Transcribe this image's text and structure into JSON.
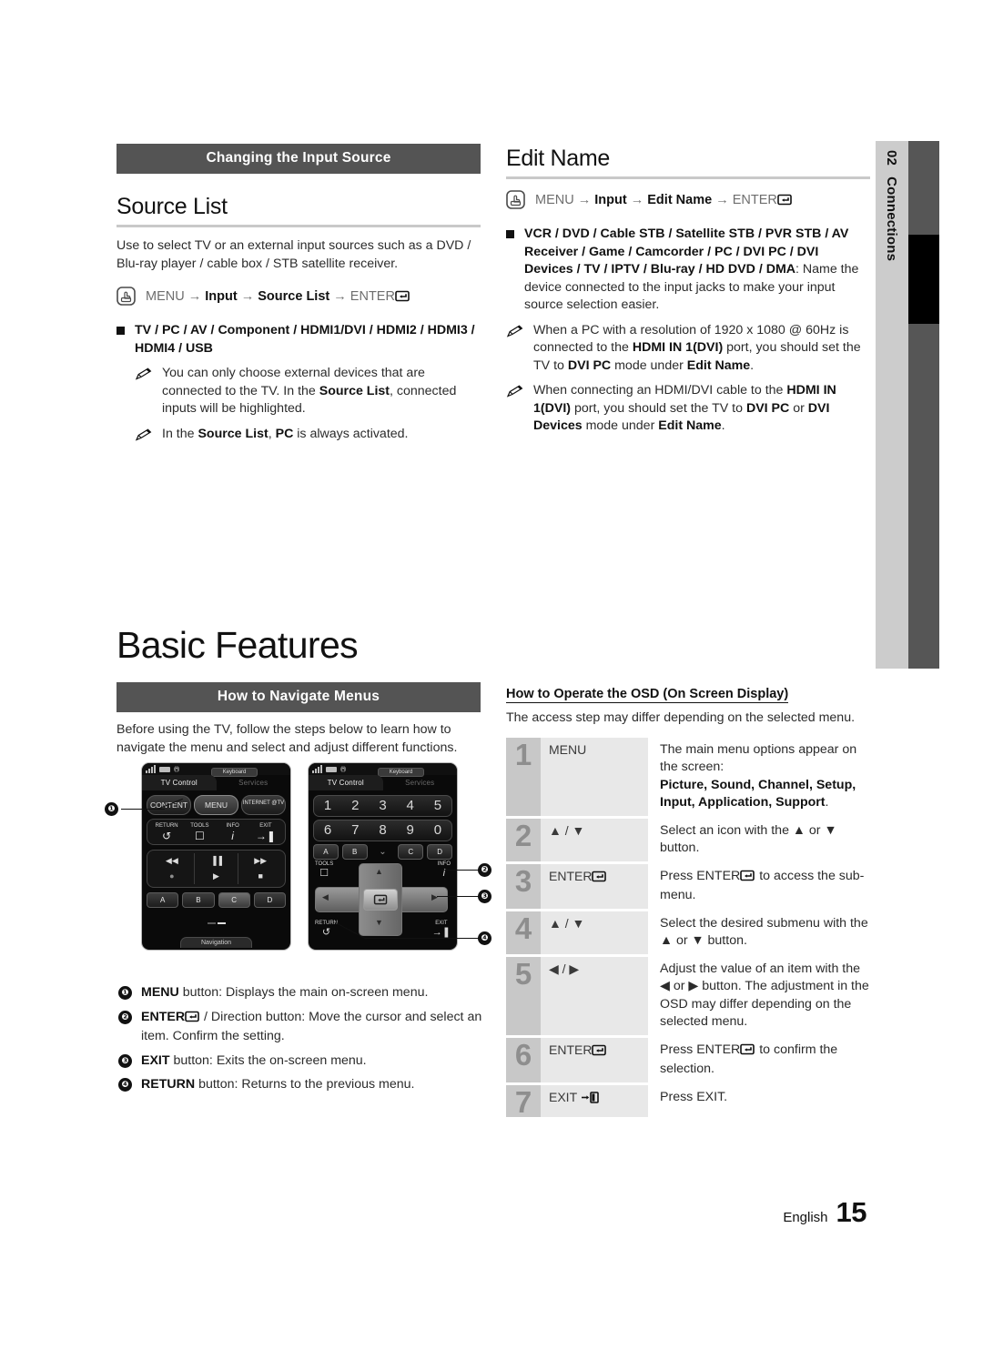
{
  "side_tab": {
    "number": "02",
    "label": "Connections"
  },
  "left_column": {
    "band_title": "Changing the Input Source",
    "section_title": "Source List",
    "intro": "Use to select TV or an external input sources such as a DVD / Blu-ray player / cable box / STB satellite receiver.",
    "path": {
      "menu": "MENU",
      "a1": "→",
      "input": "Input",
      "a2": "→",
      "target": "Source List",
      "a3": "→",
      "enter": "ENTER"
    },
    "bullet": "TV / PC / AV / Component / HDMI1/DVI / HDMI2 / HDMI3 / HDMI4 / USB",
    "notes": [
      {
        "parts": [
          {
            "t": "You can only choose external devices that are connected to the TV. In the ",
            "b": false
          },
          {
            "t": "Source List",
            "b": true
          },
          {
            "t": ", connected inputs will be highlighted.",
            "b": false
          }
        ]
      },
      {
        "parts": [
          {
            "t": "In the ",
            "b": false
          },
          {
            "t": "Source List",
            "b": true
          },
          {
            "t": ", ",
            "b": false
          },
          {
            "t": "PC",
            "b": true
          },
          {
            "t": " is always activated.",
            "b": false
          }
        ]
      }
    ]
  },
  "right_column": {
    "section_title": "Edit Name",
    "path": {
      "menu": "MENU",
      "a1": "→",
      "input": "Input",
      "a2": "→",
      "target": "Edit Name",
      "a3": "→",
      "enter": "ENTER"
    },
    "bullet_bold": "VCR / DVD / Cable STB / Satellite STB / PVR STB / AV Receiver / Game / Camcorder / PC / DVI PC / DVI Devices / TV / IPTV / Blu-ray / HD DVD / DMA",
    "bullet_rest": ": Name the device connected to the input jacks to make your input source selection easier.",
    "notes": [
      {
        "parts": [
          {
            "t": "When a PC with a resolution of 1920 x 1080 @ 60Hz is connected to the ",
            "b": false
          },
          {
            "t": "HDMI IN 1",
            "b": true
          },
          {
            "t": "(DVI)",
            "b": true
          },
          {
            "t": " port, you should set the TV to ",
            "b": false
          },
          {
            "t": "DVI PC",
            "b": true
          },
          {
            "t": " mode under ",
            "b": false
          },
          {
            "t": "Edit Name",
            "b": true
          },
          {
            "t": ".",
            "b": false
          }
        ]
      },
      {
        "parts": [
          {
            "t": "When connecting an HDMI/DVI cable to the ",
            "b": false
          },
          {
            "t": "HDMI IN 1",
            "b": true
          },
          {
            "t": "(DVI)",
            "b": true
          },
          {
            "t": " port, you should set the TV to ",
            "b": false
          },
          {
            "t": "DVI PC",
            "b": true
          },
          {
            "t": " or ",
            "b": false
          },
          {
            "t": "DVI Devices",
            "b": true
          },
          {
            "t": " mode under ",
            "b": false
          },
          {
            "t": "Edit Name",
            "b": true
          },
          {
            "t": ".",
            "b": false
          }
        ]
      }
    ]
  },
  "chapter_title": "Basic Features",
  "navigate": {
    "band_title": "How to Navigate Menus",
    "intro": "Before using the TV, follow the steps below to learn how to navigate the menu and select and adjust different functions.",
    "legend": [
      {
        "n": "❶",
        "bold": "MENU",
        "rest": " button: Displays the main on-screen menu."
      },
      {
        "n": "❷",
        "bold": "ENTER",
        "rest": " / Direction button: Move the cursor and select an item. Confirm the setting.",
        "has_enter_glyph": true
      },
      {
        "n": "❸",
        "bold": "EXIT",
        "rest": " button: Exits the on-screen menu."
      },
      {
        "n": "❹",
        "bold": "RETURN",
        "rest": " button: Returns to the previous menu."
      }
    ]
  },
  "remote_one": {
    "status": {
      "keyboard": "Keyboard"
    },
    "tabs": [
      "TV Control",
      "Services"
    ],
    "top_keys": [
      "CONTENT",
      "MENU",
      "INTERNET @TV"
    ],
    "fn_keys": [
      {
        "label": "RETURN",
        "glyph": "↺"
      },
      {
        "label": "TOOLS",
        "glyph": "☐"
      },
      {
        "label": "INFO",
        "glyph": "i"
      },
      {
        "label": "EXIT",
        "glyph": "→❚"
      }
    ],
    "transport_row1": [
      "◀◀",
      "▐▐",
      "▶▶"
    ],
    "transport_row2": [
      "●",
      "▶",
      "■"
    ],
    "color_keys": [
      "A",
      "B",
      "C",
      "D"
    ],
    "footer": "Navigation"
  },
  "remote_two": {
    "status": {
      "keyboard": "Keyboard"
    },
    "tabs": [
      "TV Control",
      "Services"
    ],
    "numbers_row1": [
      "1",
      "2",
      "3",
      "4",
      "5"
    ],
    "numbers_row2": [
      "6",
      "7",
      "8",
      "9",
      "0"
    ],
    "color_keys": [
      "A",
      "B",
      "C",
      "D"
    ],
    "chevron": "⌄",
    "corner_keys": [
      {
        "label": "TOOLS",
        "glyph": "☐"
      },
      {
        "label": "INFO",
        "glyph": "i"
      },
      {
        "label": "RETURN",
        "glyph": "↺"
      },
      {
        "label": "EXIT",
        "glyph": "→❚"
      }
    ],
    "dpad": {
      "up": "▲",
      "down": "▼",
      "left": "◀",
      "right": "▶"
    }
  },
  "callouts": [
    "❶",
    "❷",
    "❸",
    "❹"
  ],
  "osd": {
    "heading": "How to Operate the OSD (On Screen Display)",
    "subtitle": "The access step may differ depending on the selected menu.",
    "columns": [
      "step",
      "button",
      "description"
    ],
    "rows": [
      {
        "n": "1",
        "button": "MENU",
        "button_glyph": "",
        "desc_pre": "The main menu options appear on the screen:",
        "desc_bold": "Picture, Sound, Channel, Setup, Input, Application, Support",
        "desc_post": "."
      },
      {
        "n": "2",
        "button": "▲ / ▼",
        "button_glyph": "",
        "desc_pre": "Select an icon with the ▲ or ▼ button.",
        "desc_bold": "",
        "desc_post": ""
      },
      {
        "n": "3",
        "button": "ENTER",
        "button_glyph": "enter",
        "desc_pre": "Press ENTER",
        "desc_glyph": "enter",
        "desc_bold": "",
        "desc_post": " to access the sub-menu."
      },
      {
        "n": "4",
        "button": "▲ / ▼",
        "button_glyph": "",
        "desc_pre": "Select the desired submenu with the ▲ or ▼ button.",
        "desc_bold": "",
        "desc_post": ""
      },
      {
        "n": "5",
        "button": "◀ / ▶",
        "button_glyph": "",
        "desc_pre": "Adjust the value of an item with the ◀ or ▶ button. The adjustment in the OSD may differ depending on the selected menu.",
        "desc_bold": "",
        "desc_post": ""
      },
      {
        "n": "6",
        "button": "ENTER",
        "button_glyph": "enter",
        "desc_pre": "Press ENTER",
        "desc_glyph": "enter",
        "desc_bold": "",
        "desc_post": " to confirm the selection."
      },
      {
        "n": "7",
        "button": "EXIT",
        "button_glyph": "exit",
        "desc_pre": "Press EXIT.",
        "desc_bold": "",
        "desc_post": ""
      }
    ]
  },
  "footer": {
    "language": "English",
    "page": "15"
  },
  "colors": {
    "band": "#545454",
    "tab_bg": "#cccccc",
    "side_bar": "#565656",
    "accent_black": "#000000",
    "rule": "#c9c9c9",
    "osd_num_bg": "#c8c8c8",
    "osd_cell_bg": "#e8e8e8"
  }
}
